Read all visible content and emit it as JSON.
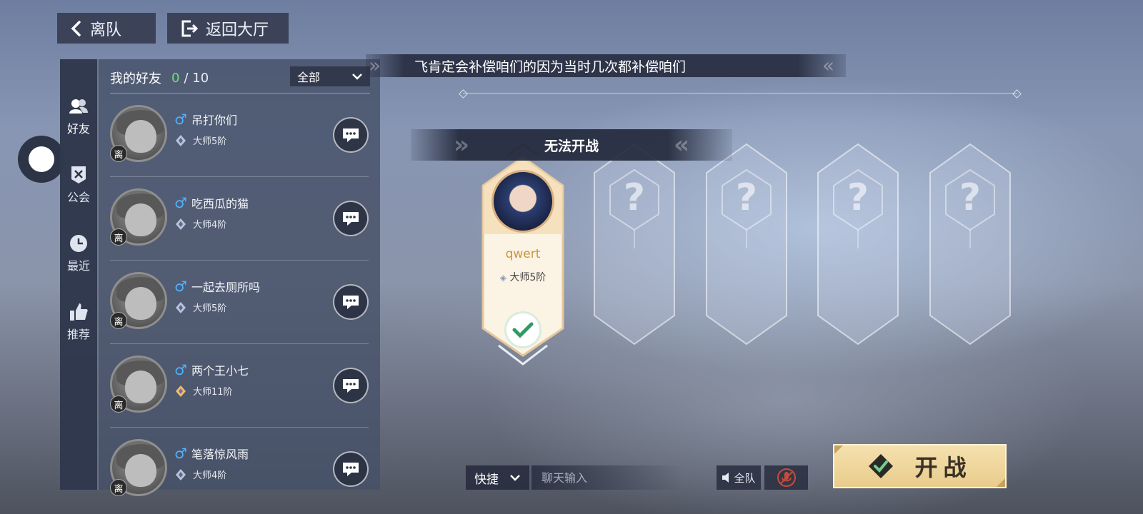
{
  "top_bar": {
    "leave_label": "离队",
    "back_lobby_label": "返回大厅"
  },
  "friend_panel": {
    "tabs": [
      {
        "label": "好友",
        "icon": "friends-icon",
        "active": true
      },
      {
        "label": "公会",
        "icon": "guild-icon",
        "active": false
      },
      {
        "label": "最近",
        "icon": "clock-icon",
        "active": false
      },
      {
        "label": "推荐",
        "icon": "thumbs-up-icon",
        "active": false
      }
    ],
    "title": "我的好友",
    "online_count": "0",
    "total_count": "/ 10",
    "filter_selected": "全部",
    "friends": [
      {
        "name": "吊打你们",
        "rank": "大师5阶",
        "status": "离"
      },
      {
        "name": "吃西瓜的猫",
        "rank": "大师4阶",
        "status": "离"
      },
      {
        "name": "一起去厕所吗",
        "rank": "大师5阶",
        "status": "离"
      },
      {
        "name": "两个王小七",
        "rank": "大师11阶",
        "status": "离"
      },
      {
        "name": "笔落惊风雨",
        "rank": "大师4阶",
        "status": "离"
      }
    ]
  },
  "notice": {
    "text": "飞肯定会补偿咱们的因为当时几次都补偿咱们"
  },
  "room": {
    "status_text": "无法开战",
    "slots": [
      {
        "filled": true,
        "name": "qwert",
        "rank": "大师5阶",
        "ready": true
      },
      {
        "filled": false,
        "placeholder": "?"
      },
      {
        "filled": false,
        "placeholder": "?"
      },
      {
        "filled": false,
        "placeholder": "?"
      },
      {
        "filled": false,
        "placeholder": "?"
      }
    ]
  },
  "chat_bar": {
    "quick_label": "快捷",
    "input_placeholder": "聊天输入",
    "voice_all_label": "全队"
  },
  "start_button": {
    "label": "开战"
  },
  "colors": {
    "online_count": "#6be36b",
    "male_icon": "#4fb2ff",
    "player_name": "#c9953e",
    "start_button": "#ecd193",
    "ready_check": "#2f9a63"
  }
}
